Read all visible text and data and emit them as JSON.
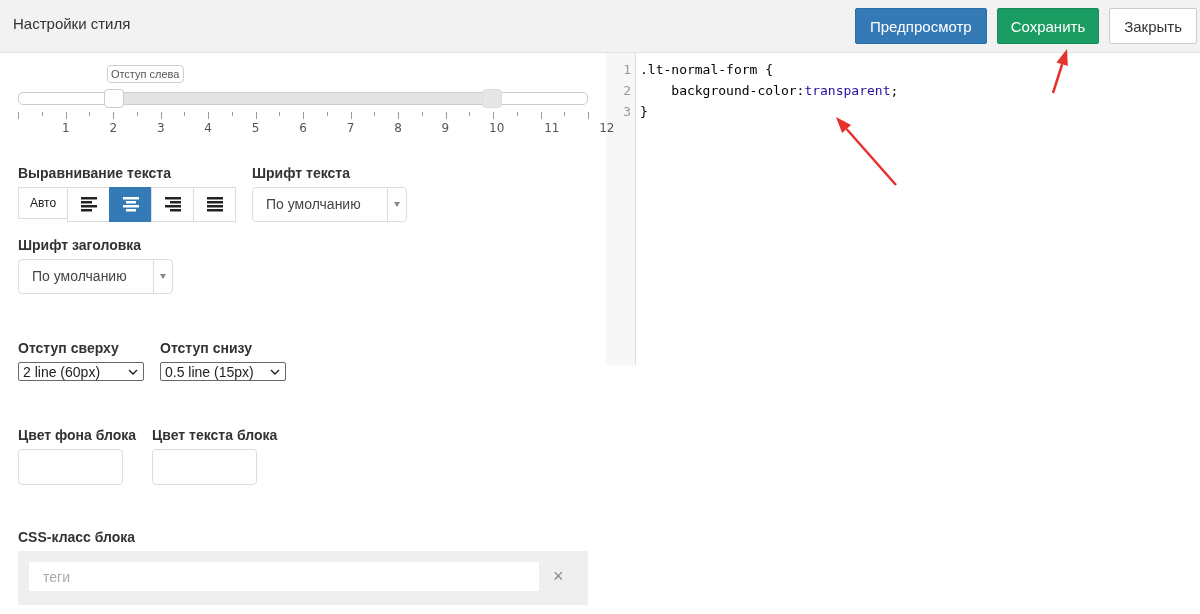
{
  "header": {
    "title": "Настройки стиля",
    "buttons": [
      {
        "label": "Предпросмотр",
        "kind": "primary"
      },
      {
        "label": "Сохранить",
        "kind": "success"
      },
      {
        "label": "Закрыть",
        "kind": "default"
      }
    ]
  },
  "indent_slider": {
    "handles": [
      {
        "level": 0.1667,
        "tooltip": "Отступ слева"
      },
      {
        "level": 0.8333
      }
    ],
    "scale_labels": "1 2 3 4 5 6 7 8 9 10 11 12"
  },
  "text_align": {
    "label": "Выравнивание текста",
    "options": [
      {
        "kind": "auto",
        "label": "Авто",
        "selected": false
      },
      {
        "kind": "left",
        "selected": false
      },
      {
        "kind": "center",
        "selected": true
      },
      {
        "kind": "right",
        "selected": false
      },
      {
        "kind": "justify",
        "selected": false
      }
    ]
  },
  "text_font": {
    "label": "Шрифт текста",
    "value": "По умолчанию"
  },
  "heading_font": {
    "label": "Шрифт заголовка",
    "value": "По умолчанию"
  },
  "margins": [
    {
      "label": "Отступ сверху",
      "value": "2 line (60px)"
    },
    {
      "label": "Отступ снизу",
      "value": "0.5 line (15px)"
    }
  ],
  "colors": [
    {
      "label": "Цвет фона блока"
    },
    {
      "label": "Цвет текста блока"
    }
  ],
  "css_class": {
    "label": "CSS-класс блока",
    "placeholder": "теги",
    "clear": "×"
  },
  "code_editor": {
    "lines": [
      {
        "number": "1",
        "tokens": [
          {
            "kind": "plain",
            "text": ".lt-normal-form {"
          }
        ]
      },
      {
        "number": "2",
        "tokens": [
          {
            "kind": "plain",
            "text": "    background-color:"
          },
          {
            "kind": "keyword",
            "text": "transparent"
          },
          {
            "kind": "plain",
            "text": ";"
          }
        ]
      },
      {
        "number": "3",
        "tokens": [
          {
            "kind": "plain",
            "text": "}"
          }
        ]
      }
    ]
  },
  "annotations": [
    {
      "kind": "arrow"
    },
    {
      "kind": "arrow"
    }
  ]
}
